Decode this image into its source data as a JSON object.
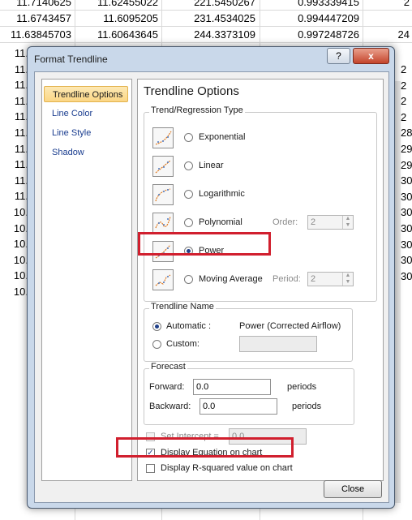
{
  "spreadsheet": {
    "rows": [
      {
        "a": "11.7140625",
        "b": "11.62455022",
        "c": "221.5450267",
        "d": "0.993339415",
        "e": "2"
      },
      {
        "a": "11.6743457",
        "b": "11.6095205",
        "c": "231.4534025",
        "d": "0.994447209",
        "e": ""
      },
      {
        "a": "11.63845703",
        "b": "11.60643645",
        "c": "244.3373109",
        "d": "0.997248726",
        "e": "24"
      }
    ],
    "left_cells": [
      "11.",
      "11.",
      "11.",
      "11.",
      "11.",
      "11.",
      "11.",
      "11.",
      "11.",
      "11.",
      "10.",
      "10.",
      "10.",
      "10.",
      "10.",
      "10."
    ],
    "right_cells": [
      "2",
      "2",
      "2",
      "2",
      "28",
      "29",
      "29",
      "30",
      "30",
      "30",
      "30",
      "30",
      "30",
      "30"
    ]
  },
  "dialog": {
    "title": "Format Trendline",
    "help": "?",
    "close_x": "x",
    "nav": [
      "Trendline Options",
      "Line Color",
      "Line Style",
      "Shadow"
    ],
    "panel_title": "Trendline Options",
    "regression_group": "Trend/Regression Type",
    "types": [
      {
        "label": "Exponential",
        "selected": false
      },
      {
        "label": "Linear",
        "selected": false
      },
      {
        "label": "Logarithmic",
        "selected": false
      },
      {
        "label": "Polynomial",
        "selected": false
      },
      {
        "label": "Power",
        "selected": true
      },
      {
        "label": "Moving Average",
        "selected": false
      }
    ],
    "order_label": "Order:",
    "order_value": "2",
    "period_label": "Period:",
    "period_value": "2",
    "name_group": "Trendline Name",
    "automatic_label": "Automatic :",
    "automatic_value": "Power (Corrected Airflow)",
    "custom_label": "Custom:",
    "custom_value": "",
    "forecast_group": "Forecast",
    "forward_label": "Forward:",
    "forward_value": "0.0",
    "forward_unit": "periods",
    "backward_label": "Backward:",
    "backward_value": "0.0",
    "backward_unit": "periods",
    "intercept_label": "Set Intercept =",
    "intercept_value": "0.0",
    "display_equation_label": "Display Equation on chart",
    "display_equation_checked": true,
    "display_rsq_label": "Display R-squared value on chart",
    "display_rsq_checked": false,
    "close_button": "Close"
  },
  "colors": {
    "highlight": "#d11f2e",
    "nav_active": "#fbd685",
    "link_blue": "#1a3d8f"
  }
}
